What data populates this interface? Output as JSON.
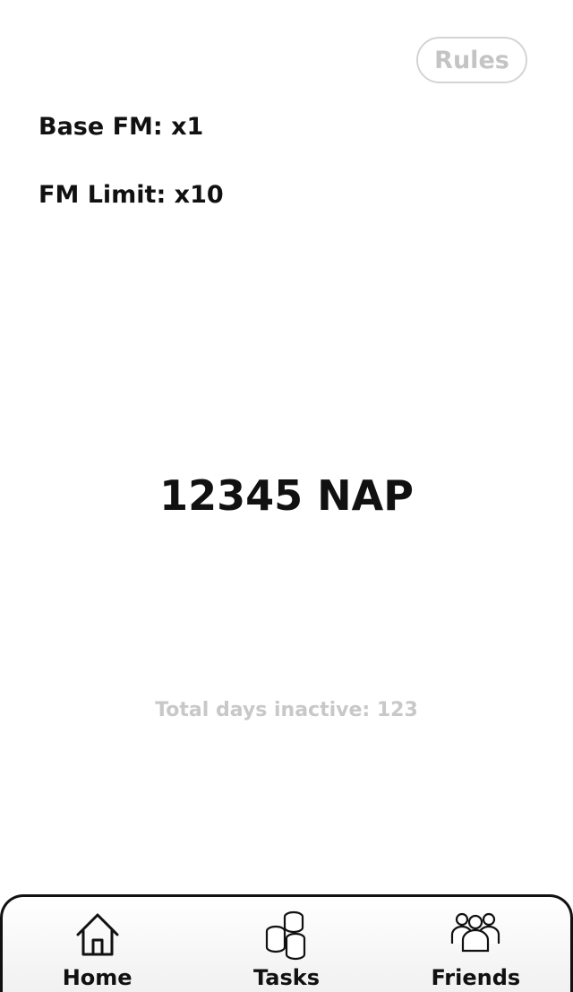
{
  "header": {
    "rules_label": "Rules"
  },
  "stats": {
    "base_fm": "Base FM: x1",
    "fm_limit": "FM Limit: x10"
  },
  "balance": {
    "text": "12345 NAP"
  },
  "inactive": {
    "text": "Total days inactive: 123"
  },
  "nav": {
    "items": [
      {
        "label": "Home",
        "icon": "home-icon"
      },
      {
        "label": "Tasks",
        "icon": "coins-icon"
      },
      {
        "label": "Friends",
        "icon": "friends-icon"
      }
    ]
  }
}
